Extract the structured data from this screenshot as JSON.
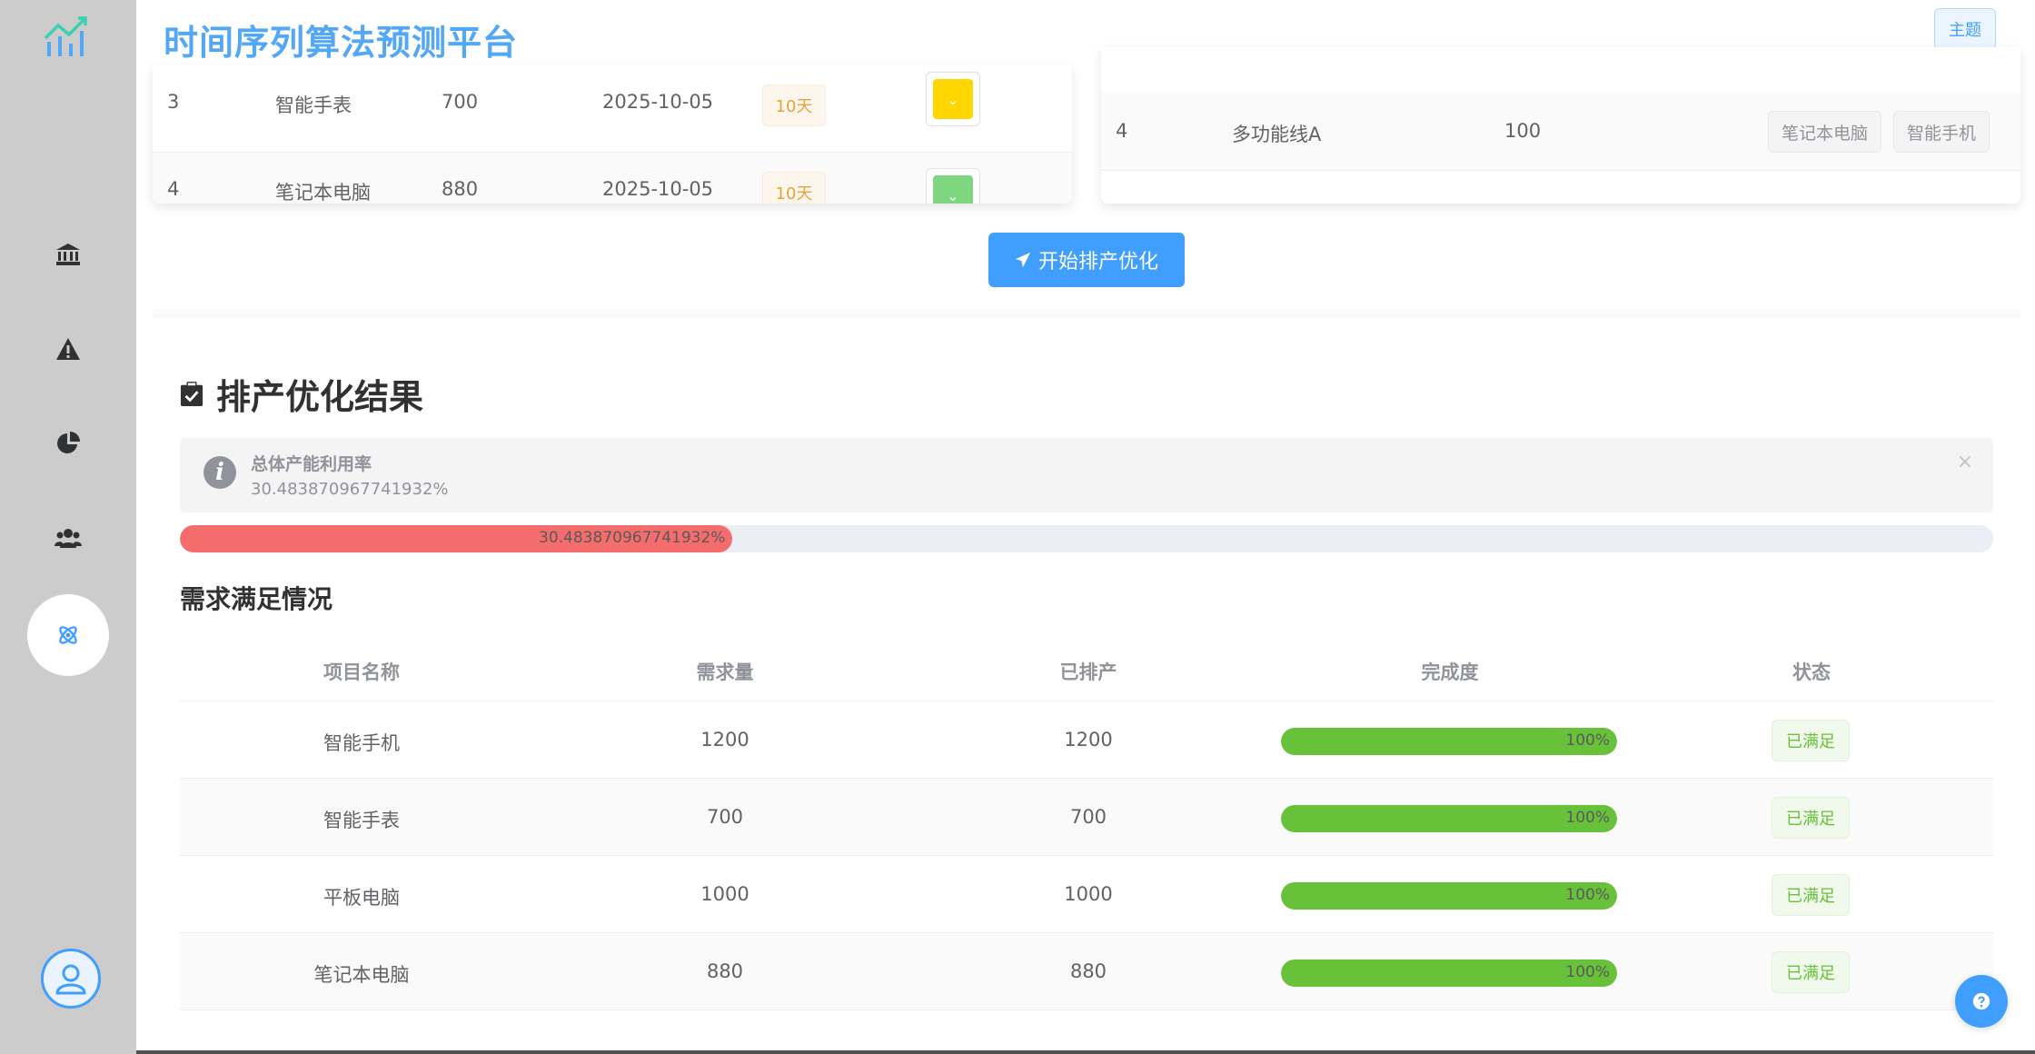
{
  "app": {
    "title": "时间序列算法预测平台",
    "theme_label": "主题"
  },
  "sidebar": {
    "items": [
      {
        "icon": "bank-icon"
      },
      {
        "icon": "warning-icon"
      },
      {
        "icon": "pie-chart-icon"
      },
      {
        "icon": "users-icon"
      },
      {
        "icon": "atom-icon",
        "active": true
      }
    ]
  },
  "orders": {
    "rows": [
      {
        "id": "3",
        "product": "智能手表",
        "qty": "700",
        "date": "2025-10-05",
        "days": "10天",
        "color": "#ffd600"
      },
      {
        "id": "4",
        "product": "笔记本电脑",
        "qty": "880",
        "date": "2025-10-05",
        "days": "10天",
        "color": "#7ed67e"
      }
    ]
  },
  "lines": {
    "rows": [
      {
        "id": "4",
        "name": "多功能线A",
        "capacity": "100",
        "products": [
          "笔记本电脑",
          "智能手机"
        ]
      }
    ]
  },
  "actions": {
    "optimize_label": "开始排产优化"
  },
  "result": {
    "title": "排产优化结果",
    "alert_title": "总体产能利用率",
    "utilization_text": "30.483870967741932%",
    "utilization_percent": 30.483870967741932,
    "progress_label": "30.483870967741932%",
    "close_symbol": "×"
  },
  "demand": {
    "title": "需求满足情况",
    "headers": [
      "项目名称",
      "需求量",
      "已排产",
      "完成度",
      "状态"
    ],
    "rows": [
      {
        "name": "智能手机",
        "demand": "1200",
        "scheduled": "1200",
        "percent": 100,
        "percent_label": "100%",
        "status": "已满足"
      },
      {
        "name": "智能手表",
        "demand": "700",
        "scheduled": "700",
        "percent": 100,
        "percent_label": "100%",
        "status": "已满足"
      },
      {
        "name": "平板电脑",
        "demand": "1000",
        "scheduled": "1000",
        "percent": 100,
        "percent_label": "100%",
        "status": "已满足"
      },
      {
        "name": "笔记本电脑",
        "demand": "880",
        "scheduled": "880",
        "percent": 100,
        "percent_label": "100%",
        "status": "已满足"
      }
    ]
  },
  "colors": {
    "primary": "#409eff",
    "danger": "#f56c6c",
    "success": "#67c23a",
    "sidebar_bg": "#cccccc"
  }
}
